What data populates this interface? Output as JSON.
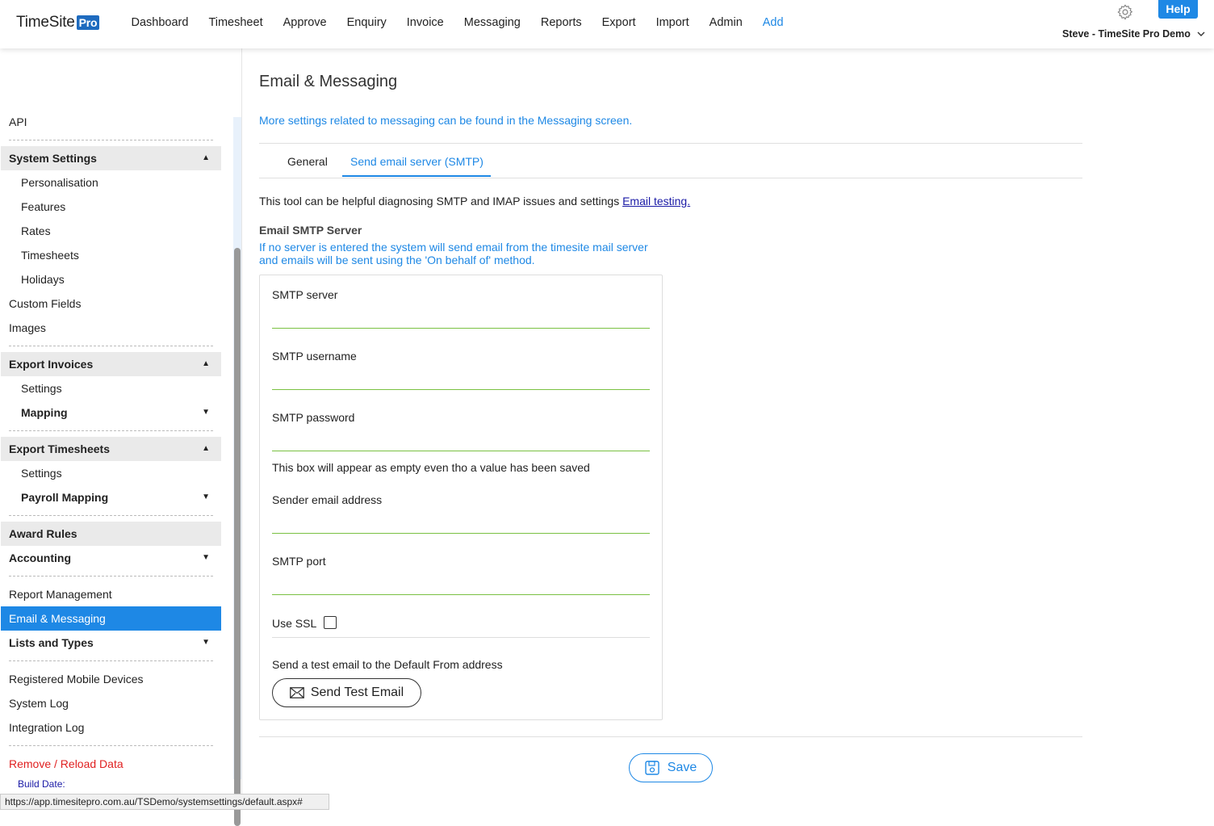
{
  "header": {
    "logo_text": "TimeSite",
    "logo_badge": "Pro",
    "nav": [
      "Dashboard",
      "Timesheet",
      "Approve",
      "Enquiry",
      "Invoice",
      "Messaging",
      "Reports",
      "Export",
      "Import",
      "Admin",
      "Add"
    ],
    "help_label": "Help",
    "user_label": "Steve - TimeSite Pro Demo"
  },
  "sidebar": {
    "api": "API",
    "system_settings": "System Settings",
    "personalisation": "Personalisation",
    "features": "Features",
    "rates": "Rates",
    "timesheets": "Timesheets",
    "holidays": "Holidays",
    "custom_fields": "Custom Fields",
    "images": "Images",
    "export_invoices": "Export Invoices",
    "ei_settings": "Settings",
    "ei_mapping": "Mapping",
    "export_timesheets": "Export Timesheets",
    "et_settings": "Settings",
    "payroll_mapping": "Payroll Mapping",
    "award_rules": "Award Rules",
    "accounting": "Accounting",
    "report_management": "Report Management",
    "email_messaging": "Email & Messaging",
    "lists_types": "Lists and Types",
    "registered_devices": "Registered Mobile Devices",
    "system_log": "System Log",
    "integration_log": "Integration Log",
    "remove_reload": "Remove / Reload Data",
    "build_date": "Build Date:"
  },
  "status_url": "https://app.timesitepro.com.au/TSDemo/systemsettings/default.aspx#",
  "main": {
    "title": "Email & Messaging",
    "info_link": "More settings related to messaging can be found in the Messaging screen.",
    "tabs": [
      "General",
      "Send email server (SMTP)"
    ],
    "helptext": "This tool can be helpful diagnosing SMTP and IMAP issues and settings ",
    "helplink": "Email testing.",
    "section_title": "Email SMTP Server",
    "section_note": "If no server is entered the system will send email from the timesite mail server and emails will be sent using the 'On behalf of' method.",
    "form": {
      "smtp_server": "SMTP server",
      "smtp_username": "SMTP username",
      "smtp_password": "SMTP password",
      "password_note": "This box will appear as empty even tho a value has been saved",
      "sender_email": "Sender email address",
      "smtp_port": "SMTP port",
      "use_ssl": "Use SSL",
      "test_note": "Send a test email to the Default From address",
      "test_button": "Send Test Email"
    },
    "save_button": "Save"
  },
  "colors": {
    "accent": "#1e88e5",
    "input_line": "#7ac142",
    "danger": "#e02020"
  }
}
